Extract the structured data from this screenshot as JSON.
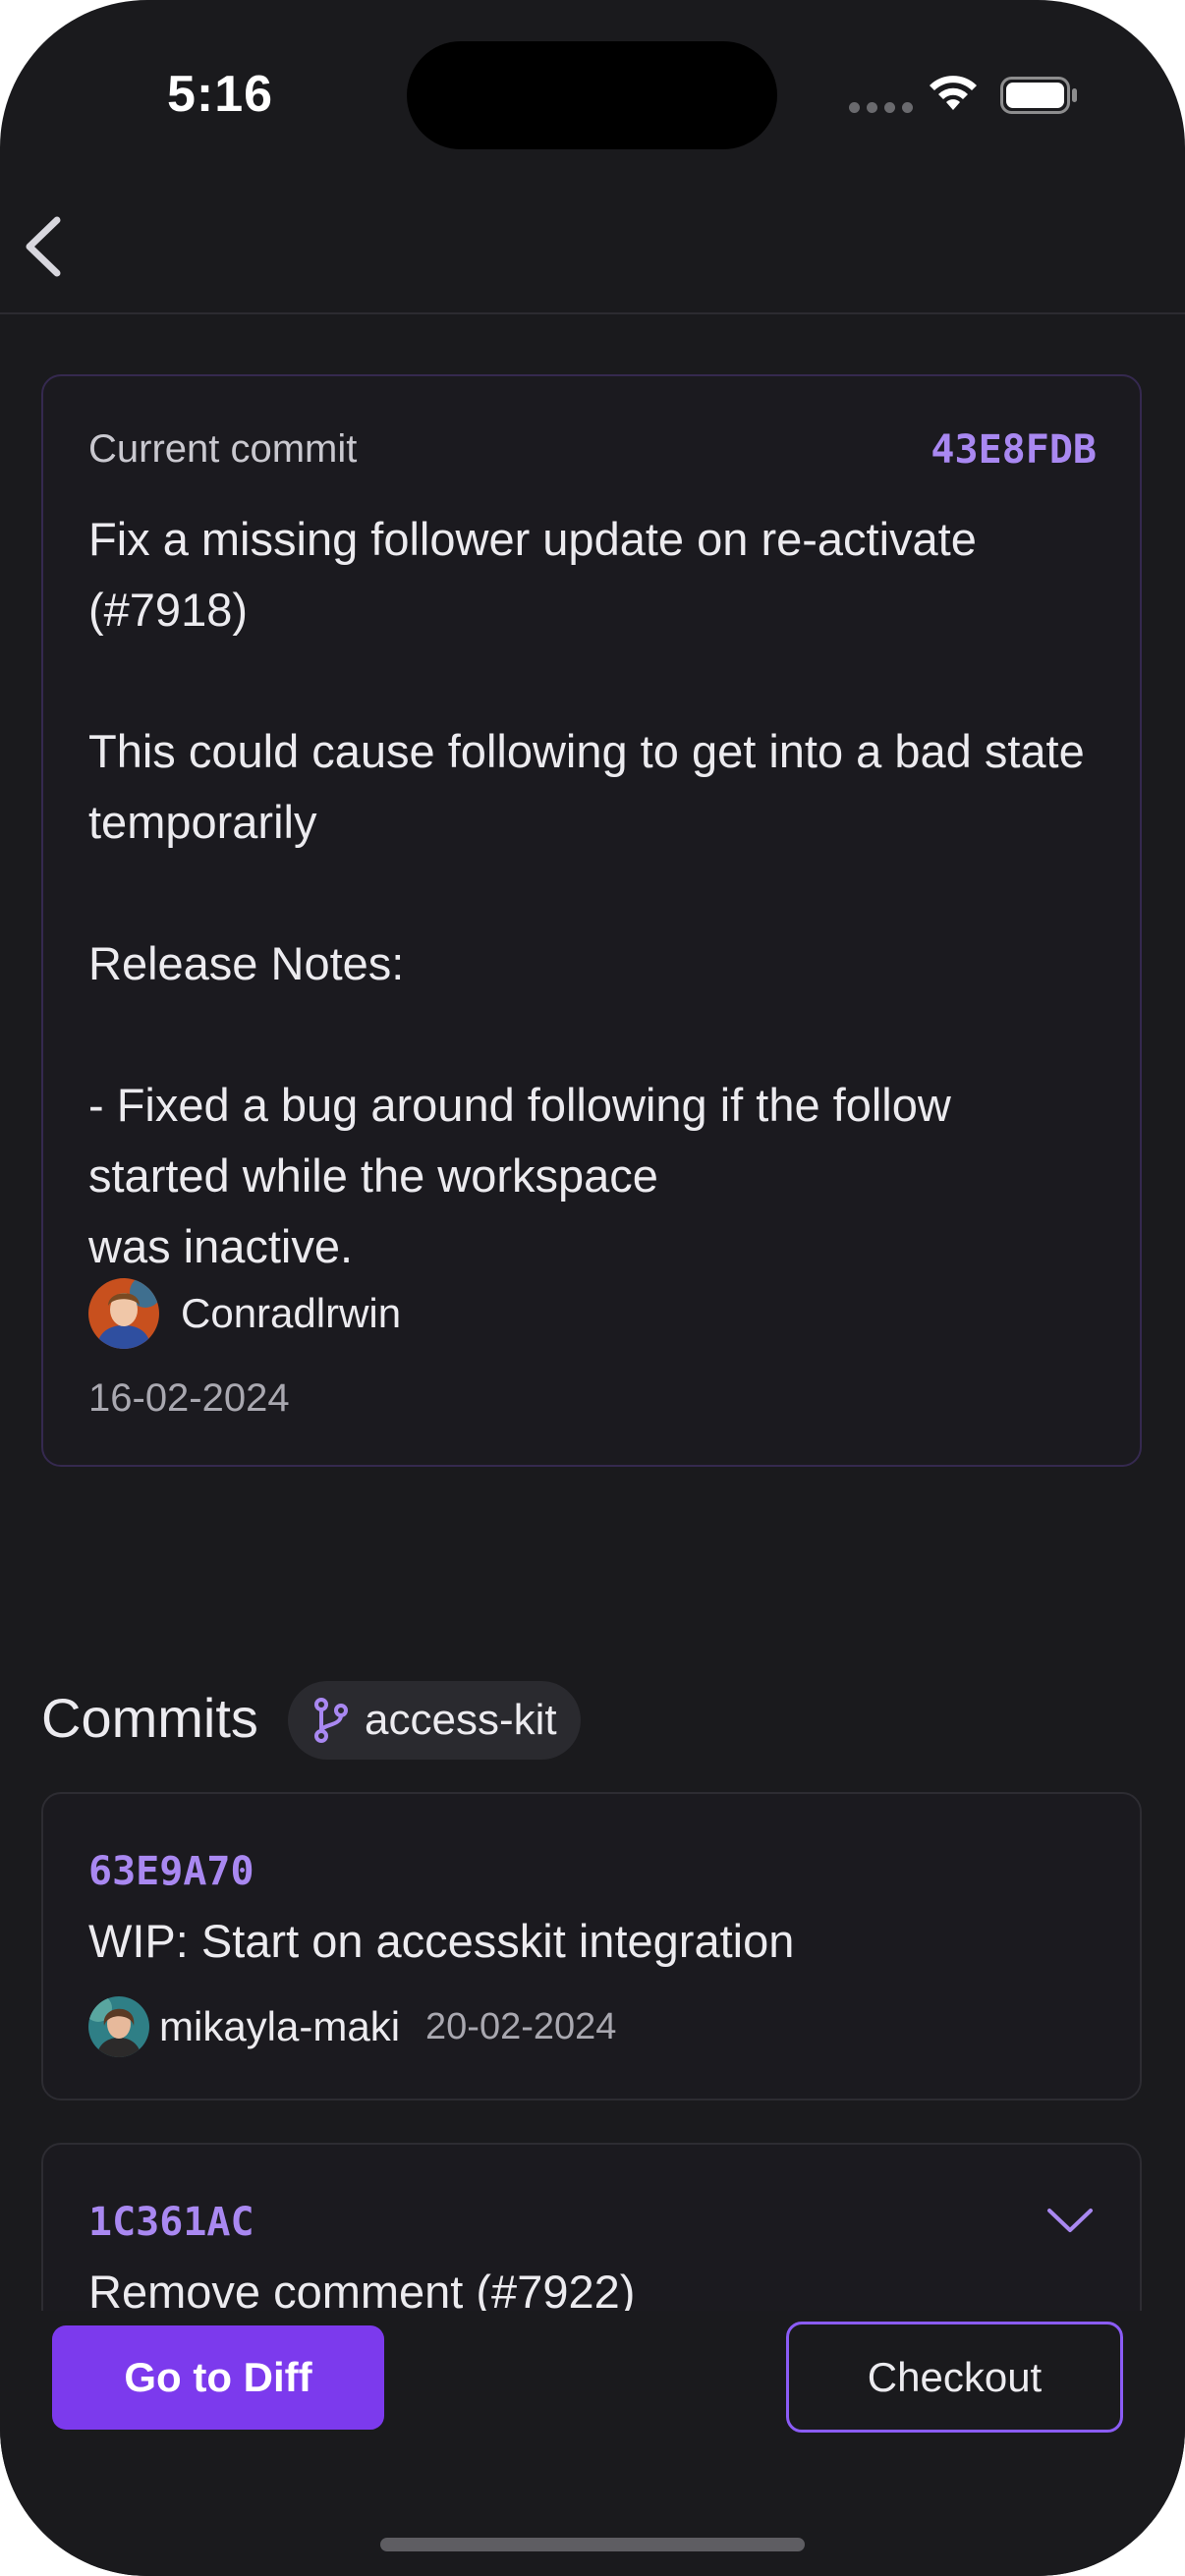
{
  "status_bar": {
    "time": "5:16"
  },
  "current_commit": {
    "label": "Current commit",
    "hash": "43E8FDB",
    "message": "Fix a missing follower update on re-activate (#7918)\n\nThis could cause following to get into a bad state temporarily\n\nRelease Notes:\n\n- Fixed a bug around following if the follow started while the workspace\nwas inactive.",
    "author": "Conradlrwin",
    "date": "16-02-2024"
  },
  "commits_section": {
    "title": "Commits",
    "branch": "access-kit",
    "items": [
      {
        "hash": "63E9A70",
        "title": "WIP: Start on accesskit integration",
        "author": "mikayla-maki",
        "date": "20-02-2024"
      },
      {
        "hash": "1C361AC",
        "title": "Remove comment (#7922)"
      }
    ]
  },
  "actions": {
    "diff_label": "Go to Diff",
    "checkout_label": "Checkout"
  },
  "colors": {
    "accent": "#7c3aed",
    "hash": "#a988f1",
    "background": "#1a1a1d",
    "card_border": "#35294f"
  },
  "icons": {
    "back": "chevron-left-icon",
    "branch": "git-branch-icon",
    "expand": "chevron-down-icon"
  }
}
